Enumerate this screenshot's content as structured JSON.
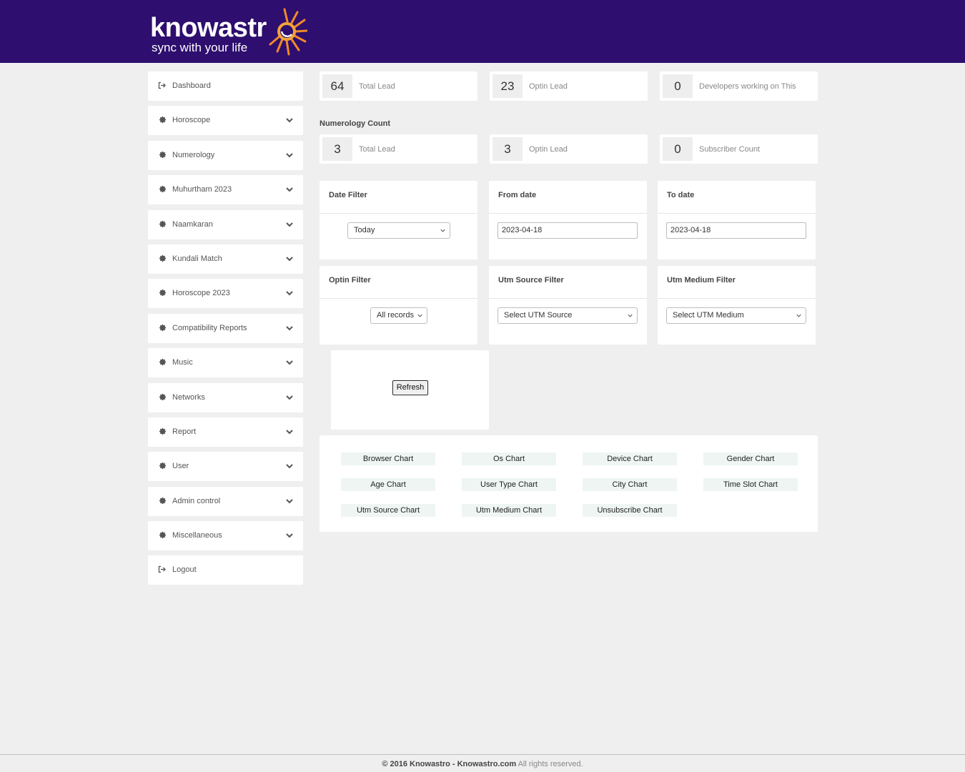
{
  "header": {
    "logo_word": "knowastr",
    "logo_tagline": "sync with your life",
    "background": "#2e0e6e"
  },
  "sidebar": {
    "items": [
      {
        "label": "Dashboard",
        "icon": "sign-in-icon",
        "expandable": false
      },
      {
        "label": "Horoscope",
        "icon": "gear-icon",
        "expandable": true
      },
      {
        "label": "Numerology",
        "icon": "gear-icon",
        "expandable": true
      },
      {
        "label": "Muhurtham 2023",
        "icon": "gear-icon",
        "expandable": true
      },
      {
        "label": "Naamkaran",
        "icon": "gear-icon",
        "expandable": true
      },
      {
        "label": "Kundali Match",
        "icon": "gear-icon",
        "expandable": true
      },
      {
        "label": "Horoscope 2023",
        "icon": "gear-icon",
        "expandable": true
      },
      {
        "label": "Compatibility Reports",
        "icon": "gear-icon",
        "expandable": true
      },
      {
        "label": "Music",
        "icon": "gear-icon",
        "expandable": true
      },
      {
        "label": "Networks",
        "icon": "gear-icon",
        "expandable": true
      },
      {
        "label": "Report",
        "icon": "gear-icon",
        "expandable": true
      },
      {
        "label": "User",
        "icon": "gear-icon",
        "expandable": true
      },
      {
        "label": "Admin control",
        "icon": "gear-icon",
        "expandable": true
      },
      {
        "label": "Miscellaneous",
        "icon": "gear-icon",
        "expandable": true
      },
      {
        "label": "Logout",
        "icon": "sign-out-icon",
        "expandable": false
      }
    ]
  },
  "stats_top": [
    {
      "value": "64",
      "label": "Total Lead"
    },
    {
      "value": "23",
      "label": "Optin Lead"
    },
    {
      "value": "0",
      "label": "Developers working on This"
    }
  ],
  "numerology": {
    "title": "Numerology Count",
    "stats": [
      {
        "value": "3",
        "label": "Total Lead"
      },
      {
        "value": "3",
        "label": "Optin Lead"
      },
      {
        "value": "0",
        "label": "Subscriber Count"
      }
    ]
  },
  "filters": {
    "date_filter": {
      "title": "Date Filter",
      "selected": "Today"
    },
    "from_date": {
      "title": "From date",
      "value": "2023-04-18"
    },
    "to_date": {
      "title": "To date",
      "value": "2023-04-18"
    },
    "optin_filter": {
      "title": "Optin Filter",
      "selected": "All records"
    },
    "utm_source_filter": {
      "title": "Utm Source Filter",
      "selected": "Select UTM Source"
    },
    "utm_medium_filter": {
      "title": "Utm Medium Filter",
      "selected": "Select UTM Medium"
    }
  },
  "refresh_label": "Refresh",
  "charts": [
    "Browser Chart",
    "Os Chart",
    "Device Chart",
    "Gender Chart",
    "Age Chart",
    "User Type Chart",
    "City Chart",
    "Time Slot Chart",
    "Utm Source Chart",
    "Utm Medium Chart",
    "Unsubscribe Chart"
  ],
  "footer": {
    "brand": "© 2016 Knowastro - Knowastro.com",
    "rights": "All rights reserved."
  }
}
